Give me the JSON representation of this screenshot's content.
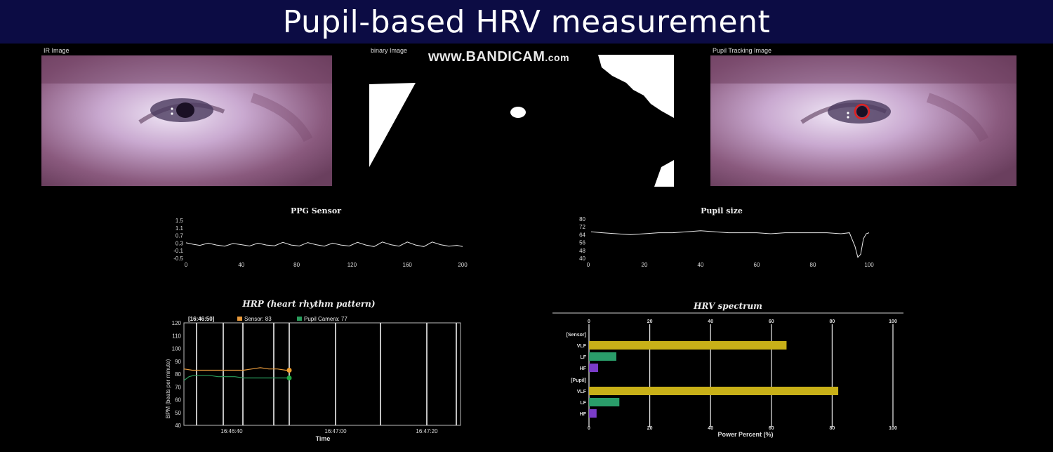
{
  "slide_title": "Pupil-based HRV measurement",
  "watermark": {
    "main": "www.BANDICAM",
    "suffix": ".com"
  },
  "panels": {
    "ir_image": "IR Image",
    "binary_image": "binary Image",
    "pupil_tracking": "Pupil Tracking Image"
  },
  "colors": {
    "banner": "#0c0c44",
    "sensor": "#e89a3c",
    "pupil": "#2a9d5c",
    "vlf": "#c8b018",
    "lf": "#2a9d6a",
    "hf": "#7a3cc8",
    "tracking_ring": "#e02020"
  },
  "chart_data": [
    {
      "type": "line",
      "title": "PPG Sensor",
      "ylim": [
        -0.5,
        1.5
      ],
      "yticks": [
        "1.5",
        "1.1",
        "0.7",
        "0.3",
        "-0.1",
        "-0.5"
      ],
      "xlim": [
        0,
        200
      ],
      "xticks": [
        "0",
        "40",
        "80",
        "120",
        "160",
        "200"
      ],
      "x": [
        0,
        5,
        10,
        16,
        22,
        28,
        34,
        40,
        46,
        52,
        58,
        64,
        70,
        76,
        82,
        88,
        94,
        100,
        106,
        112,
        118,
        124,
        130,
        136,
        142,
        148,
        154,
        160,
        166,
        172,
        178,
        184,
        190,
        196,
        200
      ],
      "y": [
        0.32,
        0.24,
        0.18,
        0.3,
        0.2,
        0.14,
        0.28,
        0.22,
        0.15,
        0.3,
        0.2,
        0.16,
        0.34,
        0.2,
        0.15,
        0.33,
        0.22,
        0.14,
        0.3,
        0.2,
        0.15,
        0.34,
        0.2,
        0.12,
        0.36,
        0.22,
        0.14,
        0.36,
        0.2,
        0.12,
        0.36,
        0.22,
        0.14,
        0.18,
        0.12
      ]
    },
    {
      "type": "line",
      "title": "Pupil size",
      "ylim": [
        40,
        80
      ],
      "yticks": [
        "80",
        "72",
        "64",
        "56",
        "48",
        "40"
      ],
      "xlim": [
        0,
        100
      ],
      "xticks": [
        "0",
        "20",
        "40",
        "60",
        "80",
        "100"
      ],
      "x": [
        1,
        5,
        10,
        15,
        20,
        25,
        30,
        35,
        40,
        45,
        50,
        55,
        60,
        65,
        70,
        75,
        80,
        85,
        90,
        93,
        95,
        96,
        97,
        98,
        99,
        100
      ],
      "y": [
        67,
        66,
        65,
        64,
        65,
        66,
        66,
        67,
        68,
        67,
        66,
        66,
        66,
        65,
        66,
        66,
        66,
        66,
        65,
        66,
        52,
        41,
        44,
        60,
        65,
        66
      ]
    },
    {
      "type": "line",
      "title": "HRP (heart rhythm pattern)",
      "xlabel": "Time",
      "ylabel": "BPM (beats per minute)",
      "ylim": [
        40,
        120
      ],
      "yticks": [
        "120",
        "110",
        "100",
        "90",
        "80",
        "70",
        "60",
        "50",
        "40"
      ],
      "xticks": [
        "16:46:40",
        "16:47:00",
        "16:47:20"
      ],
      "legend_time": "[16:46:50]",
      "series": [
        {
          "name": "Sensor: 83",
          "x": [
            0,
            5,
            10,
            15,
            20,
            25,
            30,
            35,
            40,
            45,
            50,
            55,
            60,
            62
          ],
          "values": [
            84,
            83,
            83,
            83,
            83,
            83,
            83,
            83,
            84,
            85,
            84,
            84,
            83,
            83
          ]
        },
        {
          "name": "Pupil Camera: 77",
          "x": [
            0,
            3,
            6,
            10,
            15,
            20,
            25,
            30,
            35,
            40,
            45,
            50,
            55,
            60,
            62
          ],
          "values": [
            75,
            78,
            79,
            79,
            79,
            78,
            78,
            78,
            77,
            77,
            77,
            77,
            77,
            77,
            77
          ]
        }
      ]
    },
    {
      "type": "bar",
      "title": "HRV spectrum",
      "xlabel": "Power Percent (%)",
      "xlim": [
        0,
        100
      ],
      "xticks": [
        "0",
        "20",
        "40",
        "60",
        "80",
        "100"
      ],
      "groups": [
        {
          "label": "[Sensor]",
          "bars": [
            {
              "label": "VLF",
              "value": 65
            },
            {
              "label": "LF",
              "value": 9
            },
            {
              "label": "HF",
              "value": 3
            }
          ]
        },
        {
          "label": "[Pupil]",
          "bars": [
            {
              "label": "VLF",
              "value": 82
            },
            {
              "label": "LF",
              "value": 10
            },
            {
              "label": "HF",
              "value": 2.5
            }
          ]
        }
      ]
    }
  ]
}
